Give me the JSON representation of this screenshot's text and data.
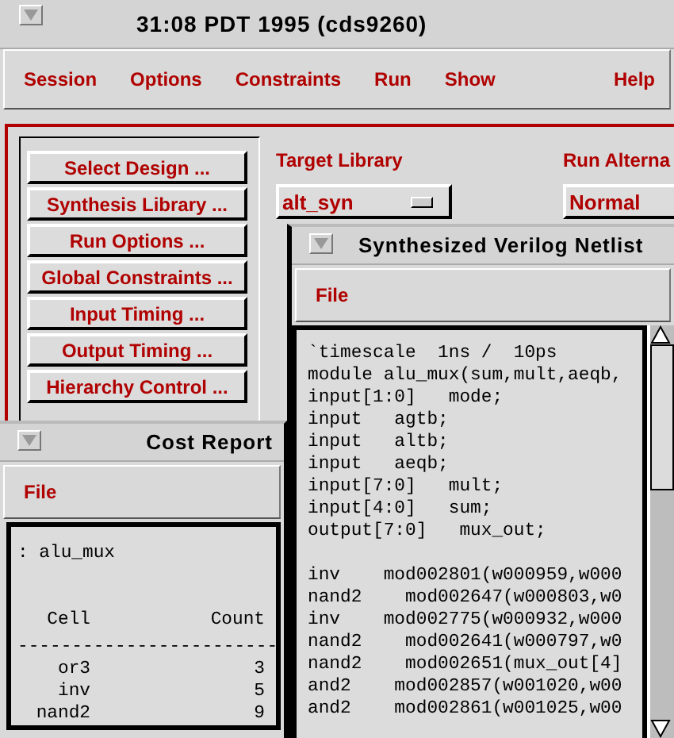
{
  "main_window": {
    "title": "31:08 PDT 1995 (cds9260)",
    "menu": [
      "Session",
      "Options",
      "Constraints",
      "Run",
      "Show",
      "Help"
    ],
    "buttons": [
      "Select Design ...",
      "Synthesis Library ...",
      "Run Options ...",
      "Global Constraints ...",
      "Input Timing ...",
      "Output Timing ...",
      "Hierarchy Control ..."
    ],
    "target_library": {
      "label": "Target Library",
      "value": "alt_syn"
    },
    "run_alternative": {
      "label": "Run Alterna",
      "value": "Normal"
    }
  },
  "netlist_window": {
    "title": "Synthesized Verilog Netlist",
    "menu": [
      "File"
    ],
    "declarations": [
      "`timescale  1ns /  10ps",
      "module alu_mux(sum,mult,aeqb,",
      "input[1:0]   mode;",
      "input   agtb;",
      "input   altb;",
      "input   aeqb;",
      "input[7:0]   mult;",
      "input[4:0]   sum;",
      "output[7:0]   mux_out;"
    ],
    "instances": [
      "inv    mod002801(w000959,w000",
      "nand2    mod002647(w000803,w0",
      "inv    mod002775(w000932,w000",
      "nand2    mod002641(w000797,w0",
      "nand2    mod002651(mux_out[4]",
      "and2    mod002857(w001020,w00",
      "and2    mod002861(w001025,w00"
    ]
  },
  "cost_report": {
    "title": "Cost Report",
    "menu": [
      "File"
    ],
    "design": ": alu_mux",
    "columns": [
      "Cell",
      "Count"
    ],
    "separator": "------------------------",
    "rows": [
      {
        "cell": "or3",
        "count": "3"
      },
      {
        "cell": "inv",
        "count": "5"
      },
      {
        "cell": "nand2",
        "count": "9"
      }
    ]
  }
}
